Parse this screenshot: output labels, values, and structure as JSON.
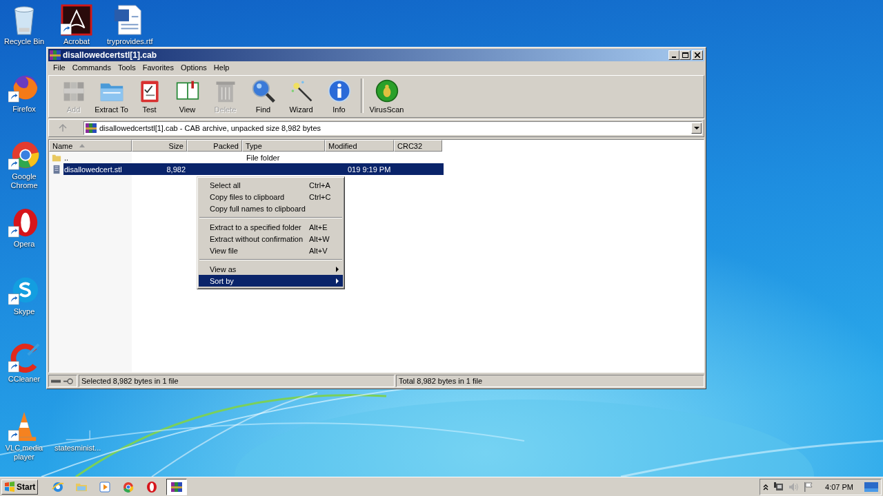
{
  "desktop_icons": [
    {
      "label": "Recycle Bin",
      "kind": "recycle",
      "shortcut": false
    },
    {
      "label": "Acrobat",
      "kind": "acrobat",
      "shortcut": true
    },
    {
      "label": "tryprovides.rtf",
      "kind": "word",
      "shortcut": false
    },
    {
      "label": "Firefox",
      "kind": "firefox",
      "shortcut": true
    },
    {
      "label": "Google Chrome",
      "kind": "chrome",
      "shortcut": true
    },
    {
      "label": "Opera",
      "kind": "opera",
      "shortcut": true
    },
    {
      "label": "Skype",
      "kind": "skype",
      "shortcut": true
    },
    {
      "label": "CCleaner",
      "kind": "ccleaner",
      "shortcut": true
    },
    {
      "label": "VLC media player",
      "kind": "vlc",
      "shortcut": true
    },
    {
      "label": "statesminist...",
      "kind": "blank",
      "shortcut": false
    }
  ],
  "window": {
    "title": "disallowedcertstl[1].cab",
    "menu": [
      "File",
      "Commands",
      "Tools",
      "Favorites",
      "Options",
      "Help"
    ],
    "toolbar": [
      {
        "label": "Add",
        "kind": "add",
        "disabled": true
      },
      {
        "label": "Extract To",
        "kind": "extract",
        "disabled": false
      },
      {
        "label": "Test",
        "kind": "test",
        "disabled": false
      },
      {
        "label": "View",
        "kind": "view",
        "disabled": false
      },
      {
        "label": "Delete",
        "kind": "delete",
        "disabled": true
      },
      {
        "label": "Find",
        "kind": "find",
        "disabled": false
      },
      {
        "label": "Wizard",
        "kind": "wizard",
        "disabled": false
      },
      {
        "label": "Info",
        "kind": "info",
        "disabled": false
      },
      {
        "label": "VirusScan",
        "kind": "virus",
        "disabled": false
      }
    ],
    "address": "disallowedcertstl[1].cab - CAB archive, unpacked size 8,982 bytes",
    "columns": [
      {
        "label": "Name",
        "sorted": true
      },
      {
        "label": "Size",
        "sorted": false
      },
      {
        "label": "Packed",
        "sorted": false
      },
      {
        "label": "Type",
        "sorted": false
      },
      {
        "label": "Modified",
        "sorted": false
      },
      {
        "label": "CRC32",
        "sorted": false
      }
    ],
    "rows": [
      {
        "kind": "folder",
        "name": "..",
        "type": "File folder",
        "selected": false
      },
      {
        "kind": "file",
        "name": "disallowedcert.stl",
        "size": "8,982",
        "modified": "019 9:19 PM",
        "selected": true
      }
    ],
    "context_menu": [
      {
        "items": [
          {
            "label": "Select all",
            "shortcut": "Ctrl+A",
            "submenu": false,
            "selected": false
          },
          {
            "label": "Copy files to clipboard",
            "shortcut": "Ctrl+C",
            "submenu": false,
            "selected": false
          },
          {
            "label": "Copy full names to clipboard",
            "submenu": false,
            "selected": false
          }
        ]
      },
      {
        "items": [
          {
            "label": "Extract to a specified folder",
            "shortcut": "Alt+E",
            "submenu": false,
            "selected": false
          },
          {
            "label": "Extract without confirmation",
            "shortcut": "Alt+W",
            "submenu": false,
            "selected": false
          },
          {
            "label": "View file",
            "shortcut": "Alt+V",
            "submenu": false,
            "selected": false
          }
        ]
      },
      {
        "items": [
          {
            "label": "View as",
            "submenu": true,
            "selected": false
          },
          {
            "label": "Sort by",
            "submenu": true,
            "selected": true
          }
        ]
      }
    ],
    "status_bar": {
      "selected": "Selected 8,982 bytes in 1 file",
      "total": "Total 8,982 bytes in 1 file"
    }
  },
  "taskbar": {
    "start": "Start",
    "apps": [
      {
        "kind": "ie",
        "active": false
      },
      {
        "kind": "explorer",
        "active": false
      },
      {
        "kind": "media",
        "active": false
      },
      {
        "kind": "chrome",
        "active": false
      },
      {
        "kind": "opera",
        "active": false
      },
      {
        "kind": "winrar",
        "active": true
      }
    ],
    "clock": "4:07 PM"
  }
}
